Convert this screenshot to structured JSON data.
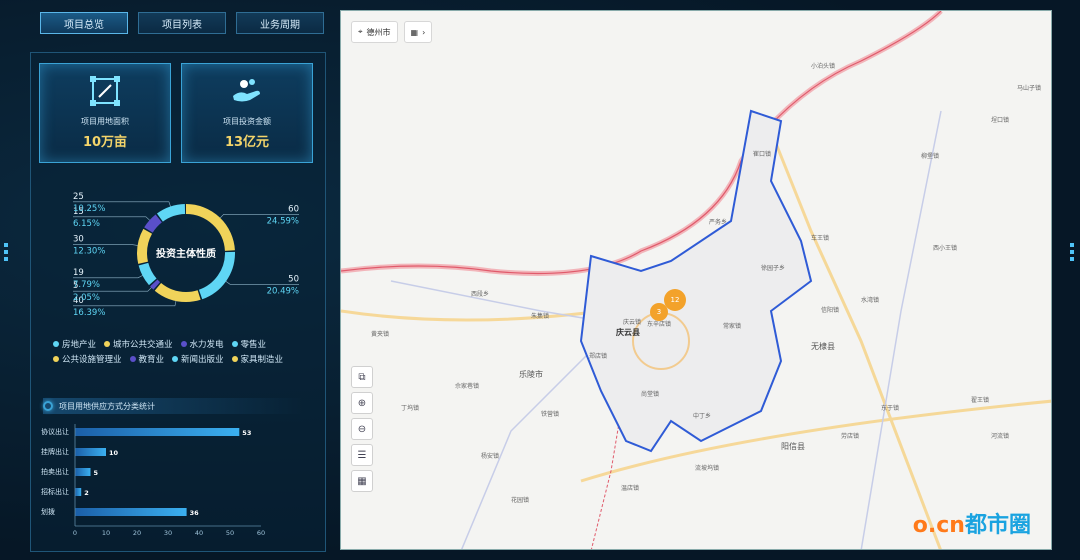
{
  "tabs": [
    {
      "label": "项目总览",
      "active": true
    },
    {
      "label": "项目列表",
      "active": false
    },
    {
      "label": "业务周期",
      "active": false
    }
  ],
  "stats": [
    {
      "label": "项目用地面积",
      "value": "10万亩",
      "icon": "land-area-icon"
    },
    {
      "label": "项目投资金额",
      "value": "13亿元",
      "icon": "investment-icon"
    }
  ],
  "donut": {
    "title": "投资主体性质",
    "segments": [
      {
        "name": "房地产业",
        "value": 60,
        "pct": "24.59%",
        "color": "#f0d35a"
      },
      {
        "name": "城市公共交通业",
        "value": 50,
        "pct": "20.49%",
        "color": "#5fd6f5"
      },
      {
        "name": "水力发电",
        "value": 40,
        "pct": "16.39%",
        "color": "#f0d35a"
      },
      {
        "name": "零售业",
        "value": 5,
        "pct": "2.05%",
        "color": "#5a4fc9"
      },
      {
        "name": "公共设施管理业",
        "value": 19,
        "pct": "7.79%",
        "color": "#5fd6f5"
      },
      {
        "name": "教育业",
        "value": 30,
        "pct": "12.30%",
        "color": "#f0d35a"
      },
      {
        "name": "新闻出版业",
        "value": 15,
        "pct": "6.15%",
        "color": "#5a4fc9"
      },
      {
        "name": "家具制造业",
        "value": 25,
        "pct": "10.25%",
        "color": "#5fd6f5"
      }
    ]
  },
  "legend": [
    {
      "name": "房地产业",
      "color": "#5fd6f5"
    },
    {
      "name": "城市公共交通业",
      "color": "#f0d35a"
    },
    {
      "name": "水力发电",
      "color": "#5a4fc9"
    },
    {
      "name": "零售业",
      "color": "#5fd6f5"
    },
    {
      "name": "公共设施管理业",
      "color": "#f0d35a"
    },
    {
      "name": "教育业",
      "color": "#5a4fc9"
    },
    {
      "name": "新闻出版业",
      "color": "#5fd6f5"
    },
    {
      "name": "家具制造业",
      "color": "#f0d35a"
    }
  ],
  "bar_section_title": "项目用地供应方式分类统计",
  "chart_data": {
    "type": "bar",
    "orientation": "horizontal",
    "categories": [
      "协议出让",
      "挂牌出让",
      "拍卖出让",
      "招标出让",
      "划拨"
    ],
    "values": [
      53,
      10,
      5,
      2,
      36
    ],
    "xlim": [
      0,
      60
    ],
    "xticks": [
      "0",
      "10",
      "20",
      "30",
      "40",
      "50",
      "60"
    ]
  },
  "map": {
    "city_button": "德州市",
    "clusters": [
      {
        "count": "12"
      },
      {
        "count": "3"
      }
    ],
    "county_label": "庆云县",
    "labels": [
      "崔口镇",
      "严务乡",
      "徐园子乡",
      "东辛店镇",
      "常家镇",
      "庆云镇",
      "尚堂镇",
      "中丁乡",
      "无棣县",
      "乐陵市",
      "阳信县",
      "西段乡",
      "朱集镇",
      "杨安镇",
      "铁营镇",
      "丁坞镇",
      "黄夹镇",
      "郑店镇",
      "花园镇",
      "小泊头镇",
      "马山子镇",
      "埕口镇",
      "柳堡镇",
      "车王镇",
      "西小王镇",
      "信阳镇",
      "水湾镇",
      "劳店镇",
      "东于镇",
      "流坡坞镇",
      "温店镇",
      "翟王镇",
      "河流镇",
      "佘家巷镇"
    ],
    "brand": {
      "part1": "o.cn",
      "part2": "都市圈"
    }
  }
}
